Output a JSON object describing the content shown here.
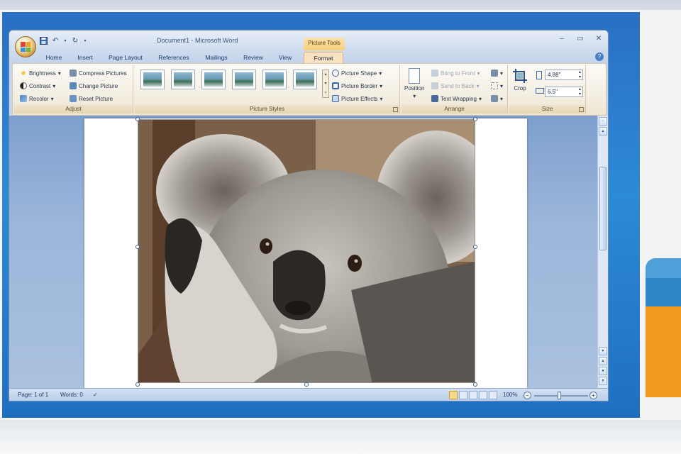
{
  "window": {
    "title": "Document1 - Microsoft Word",
    "context_tab_group": "Picture Tools"
  },
  "tabs": [
    {
      "label": "Home"
    },
    {
      "label": "Insert"
    },
    {
      "label": "Page Layout"
    },
    {
      "label": "References"
    },
    {
      "label": "Mailings"
    },
    {
      "label": "Review"
    },
    {
      "label": "View"
    },
    {
      "label": "Format",
      "active": true
    }
  ],
  "ribbon": {
    "adjust": {
      "label": "Adjust",
      "brightness": "Brightness",
      "contrast": "Contrast",
      "recolor": "Recolor",
      "compress": "Compress Pictures",
      "change": "Change Picture",
      "reset": "Reset Picture"
    },
    "picture_styles": {
      "label": "Picture Styles",
      "shape": "Picture Shape",
      "border": "Picture Border",
      "effects": "Picture Effects"
    },
    "arrange": {
      "label": "Arrange",
      "position": "Position",
      "bring_to_front": "Bring to Front",
      "send_to_back": "Send to Back",
      "text_wrapping": "Text Wrapping"
    },
    "size": {
      "label": "Size",
      "crop": "Crop",
      "height": "4.88\"",
      "width": "6.5\""
    }
  },
  "status": {
    "page": "Page: 1 of 1",
    "words": "Words: 0",
    "zoom": "100%"
  },
  "icons": {
    "office_button": "office-button-icon",
    "save": "save-icon",
    "undo": "undo-icon",
    "redo": "redo-icon",
    "help": "help-icon"
  },
  "colors": {
    "active_tab": "#f8e2c2",
    "context_tab": "#f7cf7d",
    "ribbon_bg": "#f4efe3",
    "desktop_blue": "#2d8ad6"
  }
}
